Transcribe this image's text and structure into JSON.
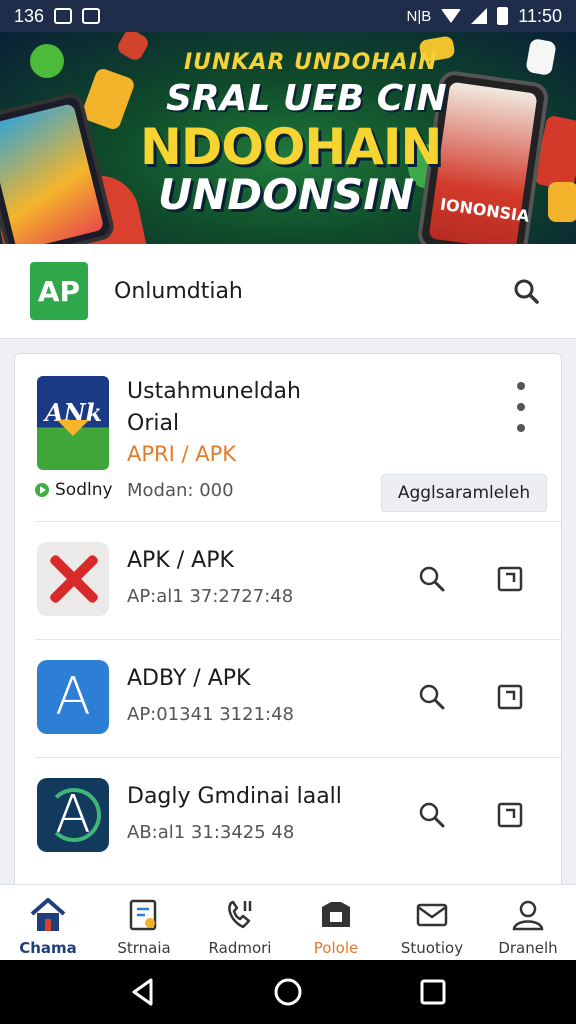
{
  "status_bar": {
    "left_text": "136",
    "time": "11:50",
    "extra": "N|B"
  },
  "banner": {
    "line1": "IUNKAR UNDOHAIN",
    "line2": "SRAL UEB  CIN",
    "line3": "NDOOHAIN",
    "line4": "UNDONSIN",
    "phone_text": "IONONSIA"
  },
  "header": {
    "logo_text": "AP",
    "app_name": "Onlumdtiah",
    "search_icon": "search-icon"
  },
  "featured": {
    "icon_text": "ANk",
    "title_line1": "Ustahmuneldah",
    "title_line2": "Orial",
    "subtitle": "APRI / APK",
    "developer": "Sodlny",
    "meta": "Modan: 000",
    "action_label": "Agglsaramleleh"
  },
  "apps": [
    {
      "title": "APK / APK",
      "sub": "AP:al1 37:2727:48",
      "icon": "red-x-icon"
    },
    {
      "title": "ADBY / APK",
      "sub": "AP:01341 3121:48",
      "icon": "a-letter-icon"
    },
    {
      "title": "Dagly Gmdinai laall",
      "sub": "AB:al1 31:3425 48",
      "icon": "a-ring-icon"
    }
  ],
  "nav": [
    {
      "label": "Chama",
      "icon": "home-icon"
    },
    {
      "label": "Strnaia",
      "icon": "apps-icon"
    },
    {
      "label": "Radmori",
      "icon": "phone-icon"
    },
    {
      "label": "Polole",
      "icon": "folder-icon"
    },
    {
      "label": "Stuotioy",
      "icon": "mail-icon"
    },
    {
      "label": "Dranelh",
      "icon": "account-icon"
    }
  ],
  "colors": {
    "status_bar": "#1f2d4a",
    "logo": "#2fa84a",
    "accent_orange": "#e57a2a",
    "nav_active": "#1e3f7a"
  }
}
